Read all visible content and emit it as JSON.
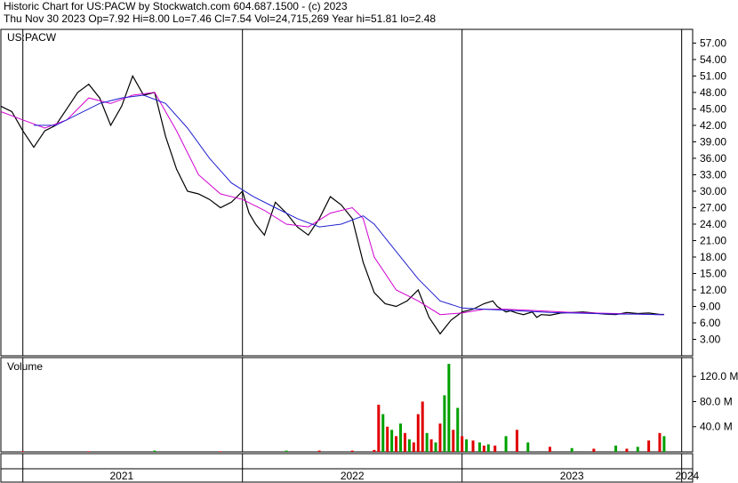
{
  "header": {
    "line1": "Historic Chart for US:PACW by Stockwatch.com 604.687.1500 - (c) 2023",
    "line2": "Thu Nov 30 2023  Op=7.92  Hi=8.00  Lo=7.46  Cl=7.54  Vol=24,715,269  Year hi=51.81  lo=2.48"
  },
  "chart_data": [
    {
      "type": "line",
      "title": "US:PACW",
      "y_ticks": [
        "57.00",
        "54.00",
        "51.00",
        "48.00",
        "45.00",
        "42.00",
        "39.00",
        "36.00",
        "33.00",
        "30.00",
        "27.00",
        "24.00",
        "21.00",
        "18.00",
        "15.00",
        "12.00",
        "9.00",
        "6.00",
        "3.00"
      ],
      "ylim": [
        0,
        59.5
      ],
      "x_categories": [
        "2021",
        "2022",
        "2023",
        "2024"
      ],
      "colors": {
        "price": "#000000",
        "ma_fast": "#d000d0",
        "ma_slow": "#2020d0"
      },
      "series": [
        {
          "key": "price",
          "x": [
            2020.9,
            2020.95,
            2021.0,
            2021.05,
            2021.1,
            2021.15,
            2021.2,
            2021.25,
            2021.3,
            2021.35,
            2021.4,
            2021.45,
            2021.5,
            2021.55,
            2021.6,
            2021.65,
            2021.7,
            2021.75,
            2021.8,
            2021.85,
            2021.9,
            2021.95,
            2022.0,
            2022.03,
            2022.06,
            2022.1,
            2022.15,
            2022.2,
            2022.25,
            2022.3,
            2022.35,
            2022.4,
            2022.45,
            2022.5,
            2022.55,
            2022.6,
            2022.65,
            2022.7,
            2022.75,
            2022.8,
            2022.85,
            2022.9,
            2022.95,
            2023.0,
            2023.05,
            2023.1,
            2023.14,
            2023.16,
            2023.18,
            2023.2,
            2023.22,
            2023.25,
            2023.28,
            2023.32,
            2023.34,
            2023.36,
            2023.4,
            2023.45,
            2023.5,
            2023.55,
            2023.6,
            2023.65,
            2023.7,
            2023.75,
            2023.8,
            2023.85,
            2023.9,
            2023.92
          ],
          "values": [
            45.5,
            44.5,
            41.0,
            38.0,
            41.0,
            42.0,
            45.0,
            48.0,
            49.5,
            47.0,
            42.0,
            45.5,
            51.0,
            47.5,
            48.0,
            40.0,
            34.0,
            30.0,
            29.5,
            28.5,
            27.0,
            28.0,
            30.0,
            26.0,
            24.0,
            22.0,
            28.0,
            26.0,
            23.5,
            22.0,
            25.0,
            29.0,
            27.5,
            25.0,
            17.0,
            11.5,
            9.5,
            9.0,
            10.0,
            12.0,
            7.0,
            4.0,
            6.5,
            8.0,
            8.5,
            9.5,
            10.0,
            9.0,
            8.5,
            8.0,
            8.2,
            7.8,
            7.5,
            8.0,
            7.0,
            7.5,
            7.4,
            7.8,
            7.9,
            8.0,
            7.8,
            7.6,
            7.5,
            7.9,
            7.7,
            7.8,
            7.54,
            7.54
          ]
        },
        {
          "key": "ma_fast",
          "x": [
            2020.9,
            2021.0,
            2021.1,
            2021.2,
            2021.3,
            2021.4,
            2021.5,
            2021.6,
            2021.7,
            2021.8,
            2021.9,
            2022.0,
            2022.1,
            2022.2,
            2022.3,
            2022.4,
            2022.5,
            2022.55,
            2022.6,
            2022.7,
            2022.8,
            2022.9,
            2023.0,
            2023.1,
            2023.2,
            2023.3,
            2023.4,
            2023.5,
            2023.6,
            2023.7,
            2023.8,
            2023.9,
            2023.92
          ],
          "values": [
            44.5,
            43.0,
            41.5,
            43.0,
            47.0,
            46.0,
            47.5,
            48.0,
            41.0,
            33.0,
            29.5,
            28.5,
            26.5,
            24.0,
            23.5,
            26.0,
            27.0,
            25.0,
            18.0,
            12.0,
            10.0,
            7.5,
            7.8,
            8.5,
            8.5,
            8.3,
            8.1,
            7.9,
            7.8,
            7.7,
            7.6,
            7.5,
            7.5
          ]
        },
        {
          "key": "ma_slow",
          "x": [
            2021.05,
            2021.15,
            2021.25,
            2021.35,
            2021.45,
            2021.55,
            2021.65,
            2021.75,
            2021.85,
            2021.95,
            2022.05,
            2022.15,
            2022.25,
            2022.35,
            2022.45,
            2022.55,
            2022.6,
            2022.7,
            2022.8,
            2022.9,
            2023.0,
            2023.1,
            2023.2,
            2023.3,
            2023.4,
            2023.5,
            2023.6,
            2023.7,
            2023.8,
            2023.9,
            2023.92
          ],
          "values": [
            42.0,
            42.0,
            44.0,
            46.0,
            47.0,
            47.5,
            46.0,
            41.5,
            36.0,
            31.5,
            29.0,
            27.0,
            25.0,
            23.5,
            24.0,
            25.5,
            24.0,
            19.0,
            14.0,
            10.0,
            8.7,
            8.5,
            8.3,
            8.1,
            7.9,
            7.8,
            7.7,
            7.6,
            7.6,
            7.5,
            7.5
          ]
        }
      ]
    },
    {
      "type": "bar",
      "title": "Volume",
      "y_ticks": [
        "120.0 M",
        "80.0 M",
        "40.0 M"
      ],
      "ylim": [
        0,
        150
      ],
      "colors": {
        "up": "#00a000",
        "down": "#e00000"
      },
      "series": [
        {
          "key": "volume",
          "x": [
            2021.0,
            2021.3,
            2021.6,
            2021.9,
            2022.2,
            2022.35,
            2022.5,
            2022.6,
            2022.62,
            2022.64,
            2022.66,
            2022.68,
            2022.7,
            2022.72,
            2022.74,
            2022.76,
            2022.78,
            2022.8,
            2022.82,
            2022.84,
            2022.86,
            2022.88,
            2022.9,
            2022.92,
            2022.94,
            2022.96,
            2022.98,
            2023.0,
            2023.02,
            2023.05,
            2023.08,
            2023.1,
            2023.12,
            2023.15,
            2023.2,
            2023.25,
            2023.3,
            2023.4,
            2023.5,
            2023.6,
            2023.7,
            2023.75,
            2023.8,
            2023.85,
            2023.9,
            2023.92
          ],
          "values": [
            1,
            1,
            2,
            1,
            2,
            2,
            2,
            3,
            75,
            60,
            40,
            35,
            25,
            45,
            30,
            20,
            15,
            60,
            80,
            30,
            20,
            15,
            45,
            90,
            140,
            35,
            70,
            25,
            20,
            18,
            15,
            10,
            12,
            10,
            25,
            35,
            15,
            8,
            6,
            5,
            10,
            5,
            8,
            18,
            30,
            25
          ],
          "up": [
            0,
            0,
            1,
            0,
            1,
            0,
            0,
            0,
            0,
            1,
            0,
            1,
            0,
            1,
            0,
            1,
            0,
            0,
            0,
            1,
            0,
            1,
            0,
            1,
            1,
            0,
            1,
            0,
            1,
            0,
            1,
            0,
            1,
            0,
            1,
            0,
            1,
            0,
            1,
            0,
            1,
            0,
            1,
            0,
            0,
            1
          ]
        }
      ]
    }
  ]
}
